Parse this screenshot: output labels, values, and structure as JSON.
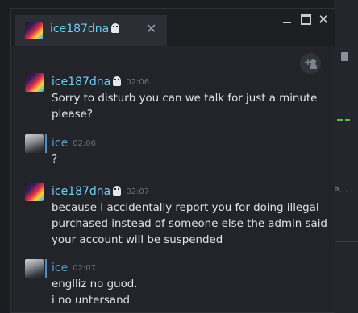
{
  "window": {
    "tab_name": "ice187dna",
    "close_label": "✕",
    "win_close_label": "✕"
  },
  "messages": [
    {
      "sender": "ice187dna",
      "time": "02:06",
      "lines": [
        "Sorry to disturb you can we talk for just a minute",
        "please?"
      ]
    },
    {
      "sender": "ice",
      "time": "02:06",
      "lines": [
        "?"
      ]
    },
    {
      "sender": "ice187dna",
      "time": "02:07",
      "lines": [
        "because I accidentally report you for doing illegal",
        "purchased instead of someone else the admin said",
        "your account will be suspended"
      ]
    },
    {
      "sender": "ice",
      "time": "02:07",
      "lines": [
        "englliz no guod.",
        "i no untersand"
      ]
    }
  ],
  "background": {
    "ellipsis": "e..."
  },
  "colors": {
    "accent": "#6dcff6",
    "window_bg": "#22242a",
    "text": "#dfe3e8",
    "timestamp": "#6b7078"
  },
  "icons": {
    "ghost_badge": "ghost-icon",
    "add_friend": "add-friend-icon"
  }
}
